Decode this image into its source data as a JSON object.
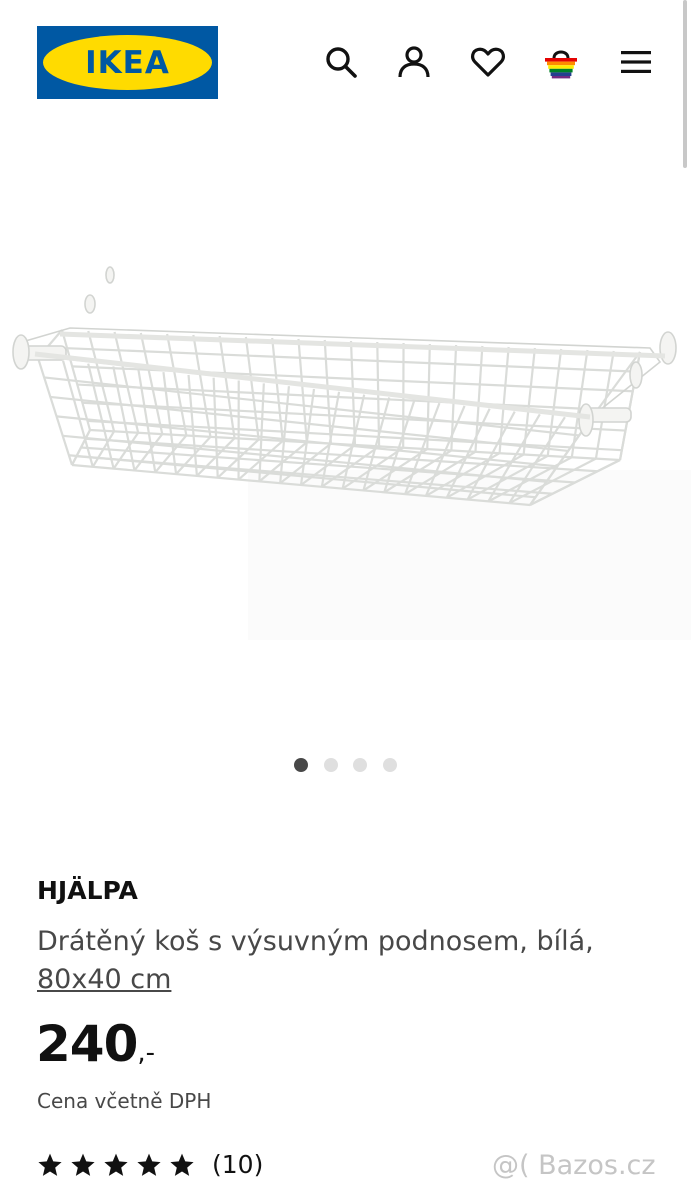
{
  "header": {
    "logo_text": "IKEA",
    "logo_reg": "®",
    "icons": [
      "search-icon",
      "user-icon",
      "heart-icon",
      "basket-icon",
      "menu-icon"
    ]
  },
  "colors": {
    "brand_blue": "#0058a3",
    "brand_yellow": "#ffdb00",
    "text_primary": "#111111",
    "text_secondary": "#484848",
    "dot_active": "#484848",
    "dot_inactive": "#dfdfdf"
  },
  "carousel": {
    "total": 4,
    "active_index": 0
  },
  "product": {
    "brand": "HJÄLPA",
    "description": "Drátěný koš s výsuvným podnosem, bílá,",
    "size": "80x40 cm",
    "price_integer": "240",
    "price_suffix": ",-",
    "vat_note": "Cena včetně DPH",
    "rating_stars": 5,
    "review_count": "(10)"
  },
  "watermark": "@( Bazos.cz"
}
